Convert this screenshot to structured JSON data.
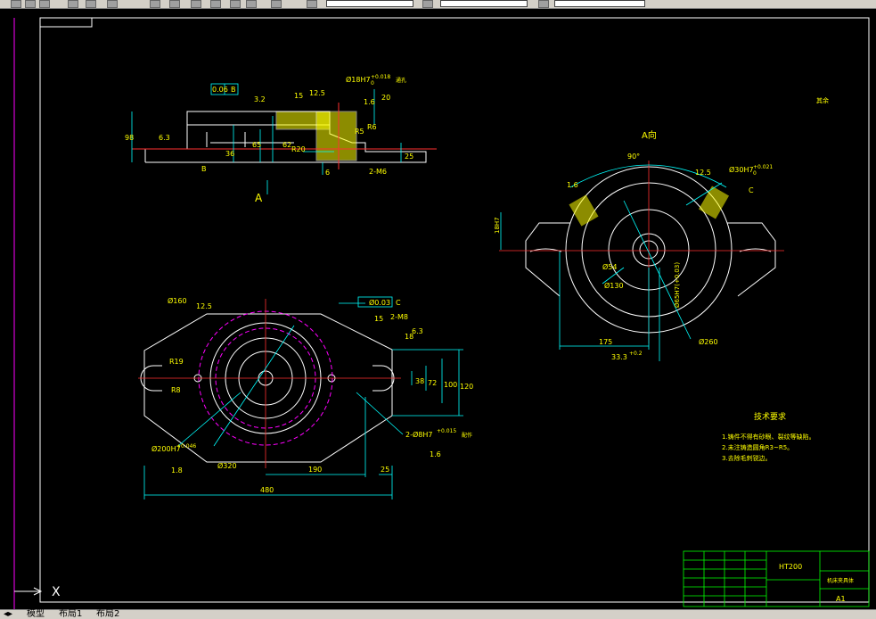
{
  "tabs": [
    {
      "label": "模型"
    },
    {
      "label": "布局1"
    },
    {
      "label": "布局2"
    }
  ],
  "ucs": {
    "x_label": "X"
  },
  "colors": {
    "background": "#000000",
    "cyan": "#00ffff",
    "yellow": "#ffff00",
    "white": "#ffffff",
    "red": "#ff3030",
    "magenta": "#ff00ff",
    "green": "#00ff00",
    "frame": "#ff00ff"
  },
  "view_top": {
    "flatness": "0.06",
    "flatness_datum": "B",
    "bore": "Ø18H7",
    "bore_tol_up": "+0.018",
    "bore_tol_low": "0",
    "bore_suffix": "通孔",
    "rough_a": "3.2",
    "rough_b": "12.5",
    "rough_c": "1.6",
    "rough_d": "6.3",
    "dim_15": "15",
    "dim_20": "20",
    "dim_r5": "R5",
    "dim_r6": "R6",
    "dim_r20": "R20",
    "dim_98": "98",
    "dim_36": "36",
    "dim_65": "65",
    "dim_62": "62",
    "dim_25": "25",
    "dim_6": "6",
    "dim_m6": "2-M6",
    "datum_b": "B",
    "view_arrow": "A"
  },
  "view_a": {
    "title": "A向",
    "angle": "90°",
    "rough_a": "12.5",
    "rough_b": "1.6",
    "bore": "Ø30H7",
    "bore_tol_up": "+0.021",
    "bore_tol_low": "0",
    "datum_c": "C",
    "dim_slot": "18H7",
    "dim_slot_tol": "+0.018",
    "dim_54": "Ø54",
    "dim_130": "Ø130",
    "dim_175": "175",
    "dim_33": "33.3",
    "dim_33_tol": "+0.2",
    "dim_260": "Ø260",
    "dim_65": "Ø65H7(+0.03)"
  },
  "view_plan": {
    "dim_160": "Ø160",
    "rough_a": "12.5",
    "concentric": "Ø0.03",
    "concentric_datum": "C",
    "dim_15": "15",
    "dim_m8": "2-M8",
    "dim_18": "18",
    "rough_b": "6.3",
    "dim_r19": "R19",
    "dim_r8": "R8",
    "dim_38": "38",
    "dim_72": "72",
    "dim_100": "100",
    "dim_120": "120",
    "dim_pin": "2-Ø8H7",
    "dim_pin_tol": "+0.015",
    "dim_pin_suffix": "配作",
    "rough_c": "1.6",
    "dim_200": "Ø200H7",
    "dim_200_tol": "+0.046",
    "rough_d": "1.8",
    "dim_320": "Ø320",
    "dim_190": "190",
    "dim_25": "25",
    "dim_480": "480"
  },
  "notes": {
    "title": "技术要求",
    "line1": "1.铸件不得有砂眼、裂纹等缺陷。",
    "line2": "2.未注铸造圆角R3~R5。",
    "line3": "3.去除毛刺锐边。",
    "top_right": "其余"
  },
  "title_block": {
    "material": "HT200",
    "name": "机床夹具体",
    "sheet": "A1"
  }
}
